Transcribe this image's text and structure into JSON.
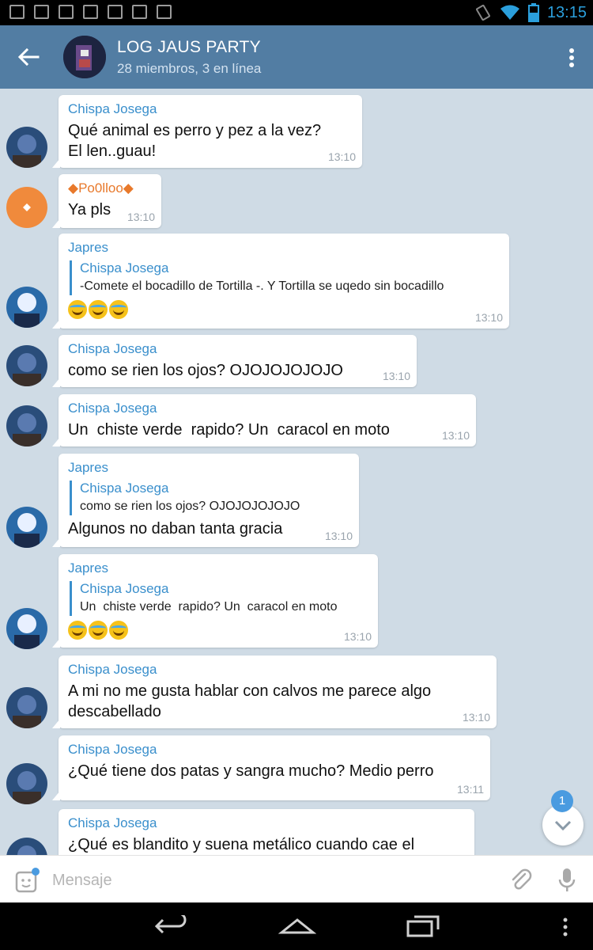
{
  "status_bar": {
    "time": "13:15"
  },
  "header": {
    "title": "LOG JAUS PARTY",
    "subtitle": "28 miembros, 3 en línea"
  },
  "messages": [
    {
      "sender": "Chispa Josega",
      "text": "Qué animal es perro y pez a la vez? El len..guau!",
      "time": "13:10"
    },
    {
      "sender": "◆Po0lloo◆",
      "text": "Ya pls",
      "time": "13:10"
    },
    {
      "sender": "Japres",
      "reply_name": "Chispa Josega",
      "reply_text": "-Comete el bocadillo de Tortilla -. Y Tortilla se uqedo sin bocadillo",
      "emojis": "😂😂😂",
      "time": "13:10"
    },
    {
      "sender": "Chispa Josega",
      "text": "como se rien los ojos? OJOJOJOJOJO",
      "time": "13:10"
    },
    {
      "sender": "Chispa Josega",
      "text": "Un  chiste verde  rapido? Un  caracol en moto",
      "time": "13:10"
    },
    {
      "sender": "Japres",
      "reply_name": "Chispa Josega",
      "reply_text": "como se rien los ojos? OJOJOJOJOJO",
      "text": "Algunos no daban tanta gracia",
      "time": "13:10"
    },
    {
      "sender": "Japres",
      "reply_name": "Chispa Josega",
      "reply_text": "Un  chiste verde  rapido? Un  caracol en moto",
      "emojis": "😂😂😂",
      "time": "13:10"
    },
    {
      "sender": "Chispa Josega",
      "text": "A mi no me gusta hablar con calvos me parece algo descabellado",
      "time": "13:10"
    },
    {
      "sender": "Chispa Josega",
      "text": "¿Qué tiene dos patas y sangra mucho? Medio perro",
      "time": "13:11"
    },
    {
      "sender": "Chispa Josega",
      "text": "¿Qué es blandito y suena metálico cuando cae el"
    }
  ],
  "scroll_badge": "1",
  "composer": {
    "placeholder": "Mensaje"
  },
  "colors": {
    "header": "#527da3",
    "accent": "#3a8fcc",
    "orange_avatar": "#f08a3c"
  }
}
